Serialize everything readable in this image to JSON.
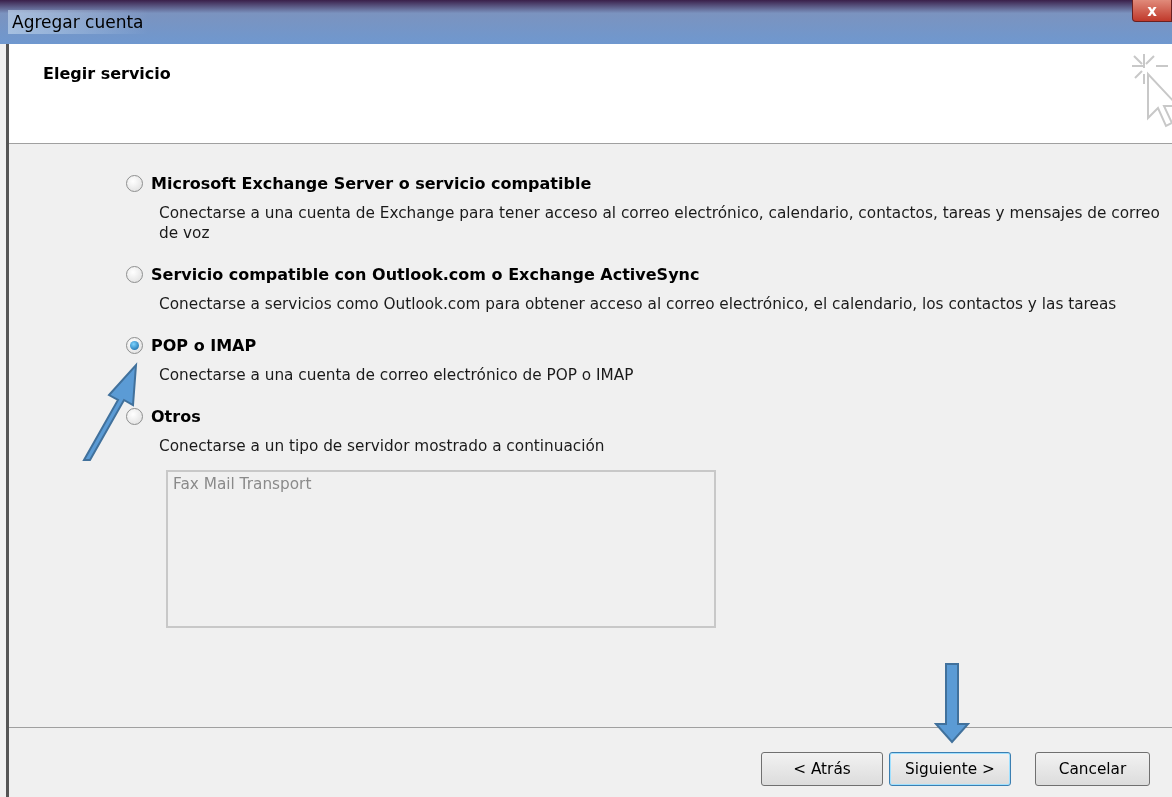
{
  "window": {
    "title": "Agregar cuenta",
    "close_label": "x"
  },
  "header": {
    "title": "Elegir servicio"
  },
  "options": [
    {
      "label": "Microsoft Exchange Server o servicio compatible",
      "description": "Conectarse a una cuenta de Exchange para tener acceso al correo electrónico, calendario, contactos, tareas y mensajes de correo de voz",
      "selected": false
    },
    {
      "label": "Servicio compatible con Outlook.com o Exchange ActiveSync",
      "description": "Conectarse a servicios como Outlook.com para obtener acceso al correo electrónico, el calendario, los contactos y las tareas",
      "selected": false
    },
    {
      "label": "POP o IMAP",
      "description": "Conectarse a una cuenta de correo electrónico de POP o IMAP",
      "selected": true
    },
    {
      "label": "Otros",
      "description": "Conectarse a un tipo de servidor mostrado a continuación",
      "selected": false
    }
  ],
  "server_list": {
    "disabled": true,
    "items": [
      "Fax Mail Transport"
    ]
  },
  "buttons": [
    {
      "label": "< Atrás",
      "default": false
    },
    {
      "label": "Siguiente >",
      "default": true
    },
    {
      "label": "Cancelar",
      "default": false
    }
  ]
}
